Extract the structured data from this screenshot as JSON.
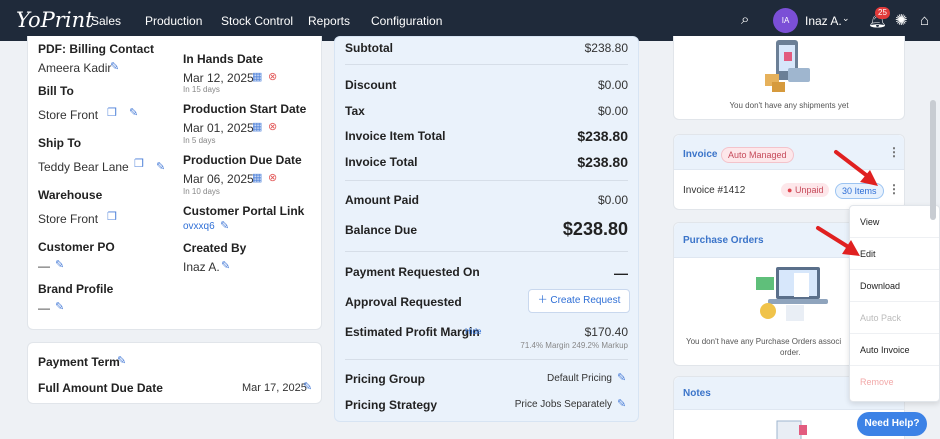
{
  "topbar": {
    "logo": "YoPrint",
    "nav": [
      "Sales",
      "Production",
      "Stock Control",
      "Reports",
      "Configuration"
    ],
    "user_initials": "IA",
    "user_name": "Inaz A.",
    "notification_count": "25"
  },
  "left": {
    "pdf_billing_contact_label": "PDF: Billing Contact",
    "pdf_billing_contact_value": "Ameera Kadir",
    "bill_to_label": "Bill To",
    "bill_to_value": "Store Front",
    "ship_to_label": "Ship To",
    "ship_to_value": "Teddy Bear Lane",
    "warehouse_label": "Warehouse",
    "warehouse_value": "Store Front",
    "customer_po_label": "Customer PO",
    "customer_po_value": "—",
    "brand_profile_label": "Brand Profile",
    "brand_profile_value": "—",
    "in_hands_label": "In Hands Date",
    "in_hands_value": "Mar 12, 2025",
    "in_hands_sub": "In 15 days",
    "prod_start_label": "Production Start Date",
    "prod_start_value": "Mar 01, 2025",
    "prod_start_sub": "In 5 days",
    "prod_due_label": "Production Due Date",
    "prod_due_value": "Mar 06, 2025",
    "prod_due_sub": "In 10 days",
    "portal_label": "Customer Portal Link",
    "portal_value": "ovxxq6",
    "created_by_label": "Created By",
    "created_by_value": "Inaz A.",
    "payment_term_label": "Payment Term",
    "full_due_label": "Full Amount Due Date",
    "full_due_value": "Mar 17, 2025"
  },
  "summary": {
    "subtotal_label": "Subtotal",
    "subtotal_value": "$238.80",
    "discount_label": "Discount",
    "discount_value": "$0.00",
    "tax_label": "Tax",
    "tax_value": "$0.00",
    "item_total_label": "Invoice Item Total",
    "item_total_value": "$238.80",
    "invoice_total_label": "Invoice Total",
    "invoice_total_value": "$238.80",
    "amount_paid_label": "Amount Paid",
    "amount_paid_value": "$0.00",
    "balance_due_label": "Balance Due",
    "balance_due_value": "$238.80",
    "payment_requested_label": "Payment Requested On",
    "payment_requested_value": "—",
    "approval_requested_label": "Approval Requested",
    "create_request_label": "Create Request",
    "profit_margin_label": "Estimated Profit Margin",
    "profit_margin_hide": "Hide",
    "profit_margin_value": "$170.40",
    "profit_margin_sub": "71.4% Margin 249.2% Markup",
    "pricing_group_label": "Pricing Group",
    "pricing_group_value": "Default Pricing",
    "pricing_strategy_label": "Pricing Strategy",
    "pricing_strategy_value": "Price Jobs Separately"
  },
  "right": {
    "shipments_empty": "You don't have any shipments yet",
    "invoice_title": "Invoice",
    "invoice_badge": "Auto Managed",
    "invoice_number": "Invoice #1412",
    "invoice_status": "Unpaid",
    "invoice_items": "30 Items",
    "purchase_orders_title": "Purchase Orders",
    "purchase_orders_empty_1": "You don't have any Purchase Orders associ",
    "purchase_orders_empty_2": "order.",
    "notes_title": "Notes",
    "menu": [
      "View",
      "Edit",
      "Download",
      "Auto Pack",
      "Auto Invoice",
      "Remove"
    ],
    "need_help": "Need Help?"
  },
  "colors": {
    "accent": "#3b74c9",
    "topbar": "#1f2a3a",
    "annotation_arrow": "#e02020"
  }
}
